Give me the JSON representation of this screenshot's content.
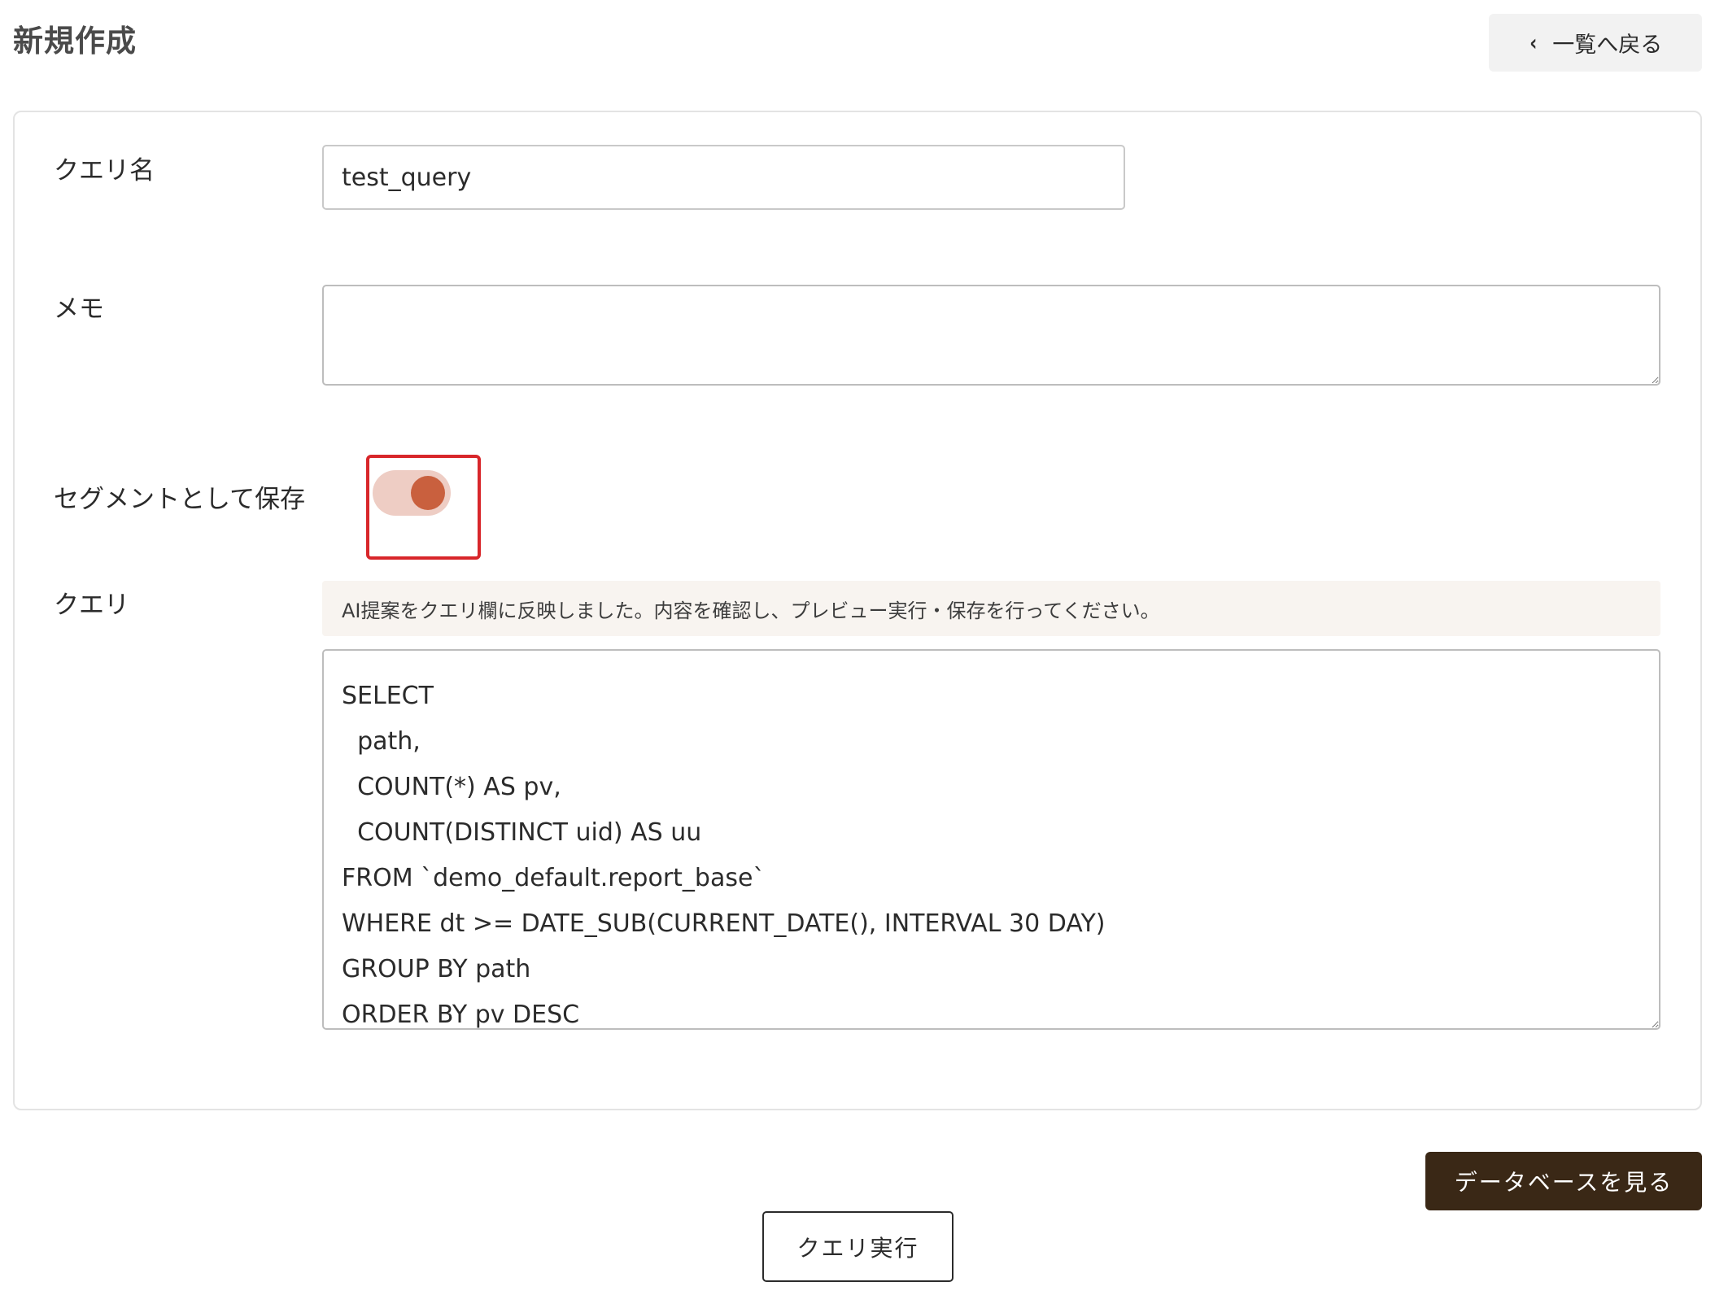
{
  "page": {
    "title": "新規作成"
  },
  "header": {
    "back_icon": "chevron-left-icon",
    "back_glyph": "‹",
    "back_label": "一覧へ戻る"
  },
  "form": {
    "query_name": {
      "label": "クエリ名",
      "value": "test_query"
    },
    "memo": {
      "label": "メモ",
      "value": ""
    },
    "segment": {
      "label": "セグメントとして保存",
      "enabled": true,
      "track_color": "#eecdc4",
      "knob_color": "#c9603e",
      "highlight_color": "#d8262a"
    },
    "query": {
      "label": "クエリ",
      "notice": "AI提案をクエリ欄に反映しました。内容を確認し、プレビュー実行・保存を行ってください。",
      "sql": "SELECT\n  path,\n  COUNT(*) AS pv,\n  COUNT(DISTINCT uid) AS uu\nFROM `demo_default.report_base`\nWHERE dt >= DATE_SUB(CURRENT_DATE(), INTERVAL 30 DAY)\nGROUP BY path\nORDER BY pv DESC"
    }
  },
  "actions": {
    "view_database_label": "データベースを見る",
    "run_query_label": "クエリ実行"
  },
  "colors": {
    "primary_dark": "#3a2816",
    "notice_bg": "#f8f4f0"
  }
}
